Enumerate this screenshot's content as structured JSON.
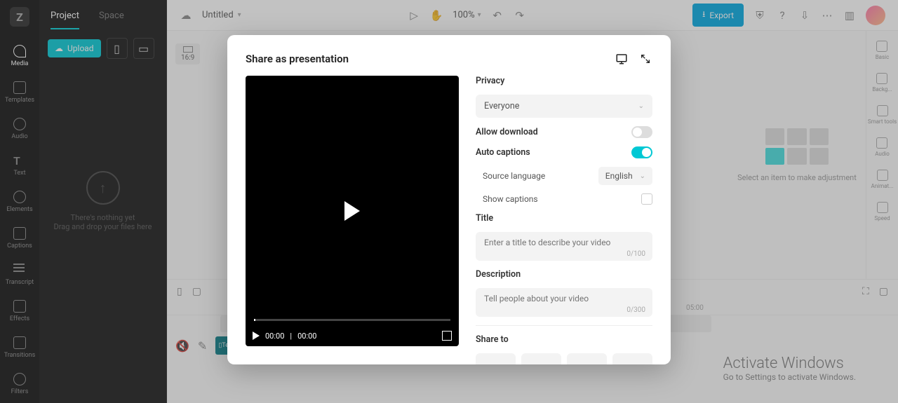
{
  "leftRail": {
    "items": [
      {
        "label": "Media"
      },
      {
        "label": "Templates"
      },
      {
        "label": "Audio"
      },
      {
        "label": "Text"
      },
      {
        "label": "Elements"
      },
      {
        "label": "Captions"
      },
      {
        "label": "Transcript"
      },
      {
        "label": "Effects"
      },
      {
        "label": "Transitions"
      },
      {
        "label": "Filters"
      }
    ]
  },
  "leftPanel": {
    "tabs": {
      "project": "Project",
      "space": "Space"
    },
    "upload": "Upload",
    "empty1": "There's nothing yet",
    "empty2": "Drag and drop your files here"
  },
  "topBar": {
    "title": "Untitled",
    "zoom": "100%",
    "export": "Export"
  },
  "canvas": {
    "aspect": "16:9"
  },
  "rightPanel": {
    "hint": "Select an item to make adjustment"
  },
  "rightRail": {
    "items": [
      {
        "label": "Basic"
      },
      {
        "label": "Backg..."
      },
      {
        "label": "Smart tools"
      },
      {
        "label": "Audio"
      },
      {
        "label": "Animat..."
      },
      {
        "label": "Speed"
      }
    ]
  },
  "timeline": {
    "t5": "05:00",
    "clip": "Temp"
  },
  "watermark": {
    "l1": "Activate Windows",
    "l2": "Go to Settings to activate Windows."
  },
  "modal": {
    "title": "Share as presentation",
    "privacy": {
      "label": "Privacy",
      "value": "Everyone"
    },
    "allowDownload": "Allow download",
    "autoCaptions": "Auto captions",
    "sourceLang": {
      "label": "Source language",
      "value": "English"
    },
    "showCaptions": "Show captions",
    "titleField": {
      "label": "Title",
      "placeholder": "Enter a title to describe your video",
      "counter": "0/100"
    },
    "desc": {
      "label": "Description",
      "placeholder": "Tell people about your video",
      "counter": "0/300"
    },
    "shareTo": "Share to",
    "time": {
      "current": "00:00",
      "sep": "|",
      "total": "00:00"
    }
  }
}
